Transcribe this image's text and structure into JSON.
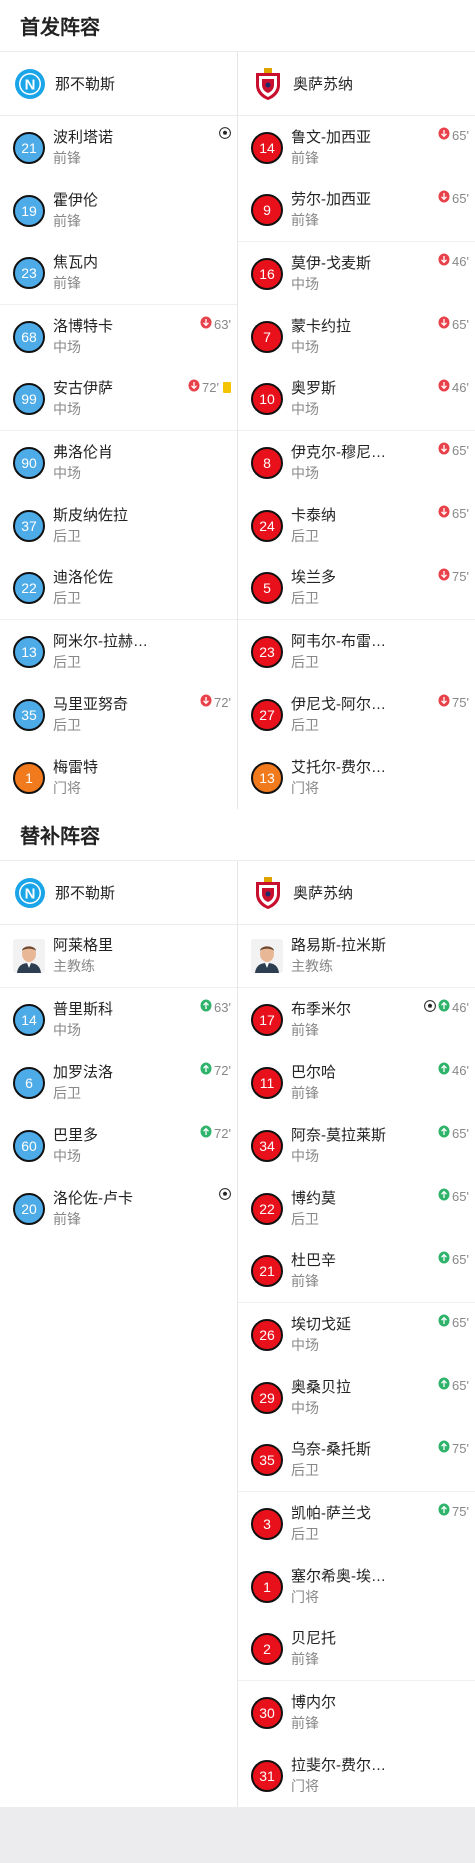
{
  "starting": {
    "title": "首发阵容",
    "home": {
      "team": "那不勒斯",
      "players": [
        {
          "num": "21",
          "name": "波利塔诺",
          "pos": "前锋",
          "color": "blue",
          "goal": true
        },
        {
          "num": "19",
          "name": "霍伊伦",
          "pos": "前锋",
          "color": "blue"
        },
        {
          "num": "23",
          "name": "焦瓦内",
          "pos": "前锋",
          "color": "blue",
          "sep": true
        },
        {
          "num": "68",
          "name": "洛博特卡",
          "pos": "中场",
          "color": "blue",
          "sub_off": "63'"
        },
        {
          "num": "99",
          "name": "安古伊萨",
          "pos": "中场",
          "color": "blue",
          "sub_off": "72'",
          "yellow": true,
          "sep": true
        },
        {
          "num": "90",
          "name": "弗洛伦肖",
          "pos": "中场",
          "color": "blue"
        },
        {
          "num": "37",
          "name": "斯皮纳佐拉",
          "pos": "后卫",
          "color": "blue"
        },
        {
          "num": "22",
          "name": "迪洛伦佐",
          "pos": "后卫",
          "color": "blue",
          "sep": true
        },
        {
          "num": "13",
          "name": "阿米尔-拉赫…",
          "pos": "后卫",
          "color": "blue"
        },
        {
          "num": "35",
          "name": "马里亚努奇",
          "pos": "后卫",
          "color": "blue",
          "sub_off": "72'"
        },
        {
          "num": "1",
          "name": "梅雷特",
          "pos": "门将",
          "color": "orange"
        }
      ]
    },
    "away": {
      "team": "奥萨苏纳",
      "players": [
        {
          "num": "14",
          "name": "鲁文-加西亚",
          "pos": "前锋",
          "color": "red",
          "sub_off": "65'"
        },
        {
          "num": "9",
          "name": "劳尔-加西亚",
          "pos": "前锋",
          "color": "red",
          "sub_off": "65'",
          "sep": true
        },
        {
          "num": "16",
          "name": "莫伊-戈麦斯",
          "pos": "中场",
          "color": "red",
          "sub_off": "46'"
        },
        {
          "num": "7",
          "name": "蒙卡约拉",
          "pos": "中场",
          "color": "red",
          "sub_off": "65'"
        },
        {
          "num": "10",
          "name": "奥罗斯",
          "pos": "中场",
          "color": "red",
          "sub_off": "46'",
          "sep": true
        },
        {
          "num": "8",
          "name": "伊克尔-穆尼…",
          "pos": "中场",
          "color": "red",
          "sub_off": "65'"
        },
        {
          "num": "24",
          "name": "卡泰纳",
          "pos": "后卫",
          "color": "red",
          "sub_off": "65'"
        },
        {
          "num": "5",
          "name": "埃兰多",
          "pos": "后卫",
          "color": "red",
          "sub_off": "75'",
          "sep": true
        },
        {
          "num": "23",
          "name": "阿韦尔-布雷…",
          "pos": "后卫",
          "color": "red"
        },
        {
          "num": "27",
          "name": "伊尼戈-阿尔…",
          "pos": "后卫",
          "color": "red",
          "sub_off": "75'"
        },
        {
          "num": "13",
          "name": "艾托尔-费尔…",
          "pos": "门将",
          "color": "orange"
        }
      ]
    }
  },
  "subs": {
    "title": "替补阵容",
    "home": {
      "team": "那不勒斯",
      "coach": {
        "name": "阿莱格里",
        "role": "主教练"
      },
      "players": [
        {
          "num": "14",
          "name": "普里斯科",
          "pos": "中场",
          "color": "blue",
          "sub_on": "63'"
        },
        {
          "num": "6",
          "name": "加罗法洛",
          "pos": "后卫",
          "color": "blue",
          "sub_on": "72'"
        },
        {
          "num": "60",
          "name": "巴里多",
          "pos": "中场",
          "color": "blue",
          "sub_on": "72'"
        },
        {
          "num": "20",
          "name": "洛伦佐-卢卡",
          "pos": "前锋",
          "color": "blue",
          "goal": true
        }
      ]
    },
    "away": {
      "team": "奥萨苏纳",
      "coach": {
        "name": "路易斯-拉米斯",
        "role": "主教练"
      },
      "players": [
        {
          "num": "17",
          "name": "布季米尔",
          "pos": "前锋",
          "color": "red",
          "sub_on": "46'",
          "goal": true
        },
        {
          "num": "11",
          "name": "巴尔哈",
          "pos": "前锋",
          "color": "red",
          "sub_on": "46'"
        },
        {
          "num": "34",
          "name": "阿奈-莫拉莱斯",
          "pos": "中场",
          "color": "red",
          "sub_on": "65'"
        },
        {
          "num": "22",
          "name": "博约莫",
          "pos": "后卫",
          "color": "red",
          "sub_on": "65'"
        },
        {
          "num": "21",
          "name": "杜巴辛",
          "pos": "前锋",
          "color": "red",
          "sub_on": "65'",
          "sep": true
        },
        {
          "num": "26",
          "name": "埃切戈延",
          "pos": "中场",
          "color": "red",
          "sub_on": "65'"
        },
        {
          "num": "29",
          "name": "奥桑贝拉",
          "pos": "中场",
          "color": "red",
          "sub_on": "65'"
        },
        {
          "num": "35",
          "name": "乌奈-桑托斯",
          "pos": "后卫",
          "color": "red",
          "sub_on": "75'",
          "sep": true
        },
        {
          "num": "3",
          "name": "凯帕-萨兰戈",
          "pos": "后卫",
          "color": "red",
          "sub_on": "75'"
        },
        {
          "num": "1",
          "name": "塞尔希奥-埃…",
          "pos": "门将",
          "color": "red"
        },
        {
          "num": "2",
          "name": "贝尼托",
          "pos": "前锋",
          "color": "red",
          "sep": true
        },
        {
          "num": "30",
          "name": "博内尔",
          "pos": "前锋",
          "color": "red"
        },
        {
          "num": "31",
          "name": "拉斐尔-费尔…",
          "pos": "门将",
          "color": "red"
        }
      ]
    }
  },
  "colors": {
    "sub_off": "#e8414a",
    "sub_on": "#2fb36b",
    "napoli": "#1aa5e8",
    "osasuna": "#c8102e"
  }
}
